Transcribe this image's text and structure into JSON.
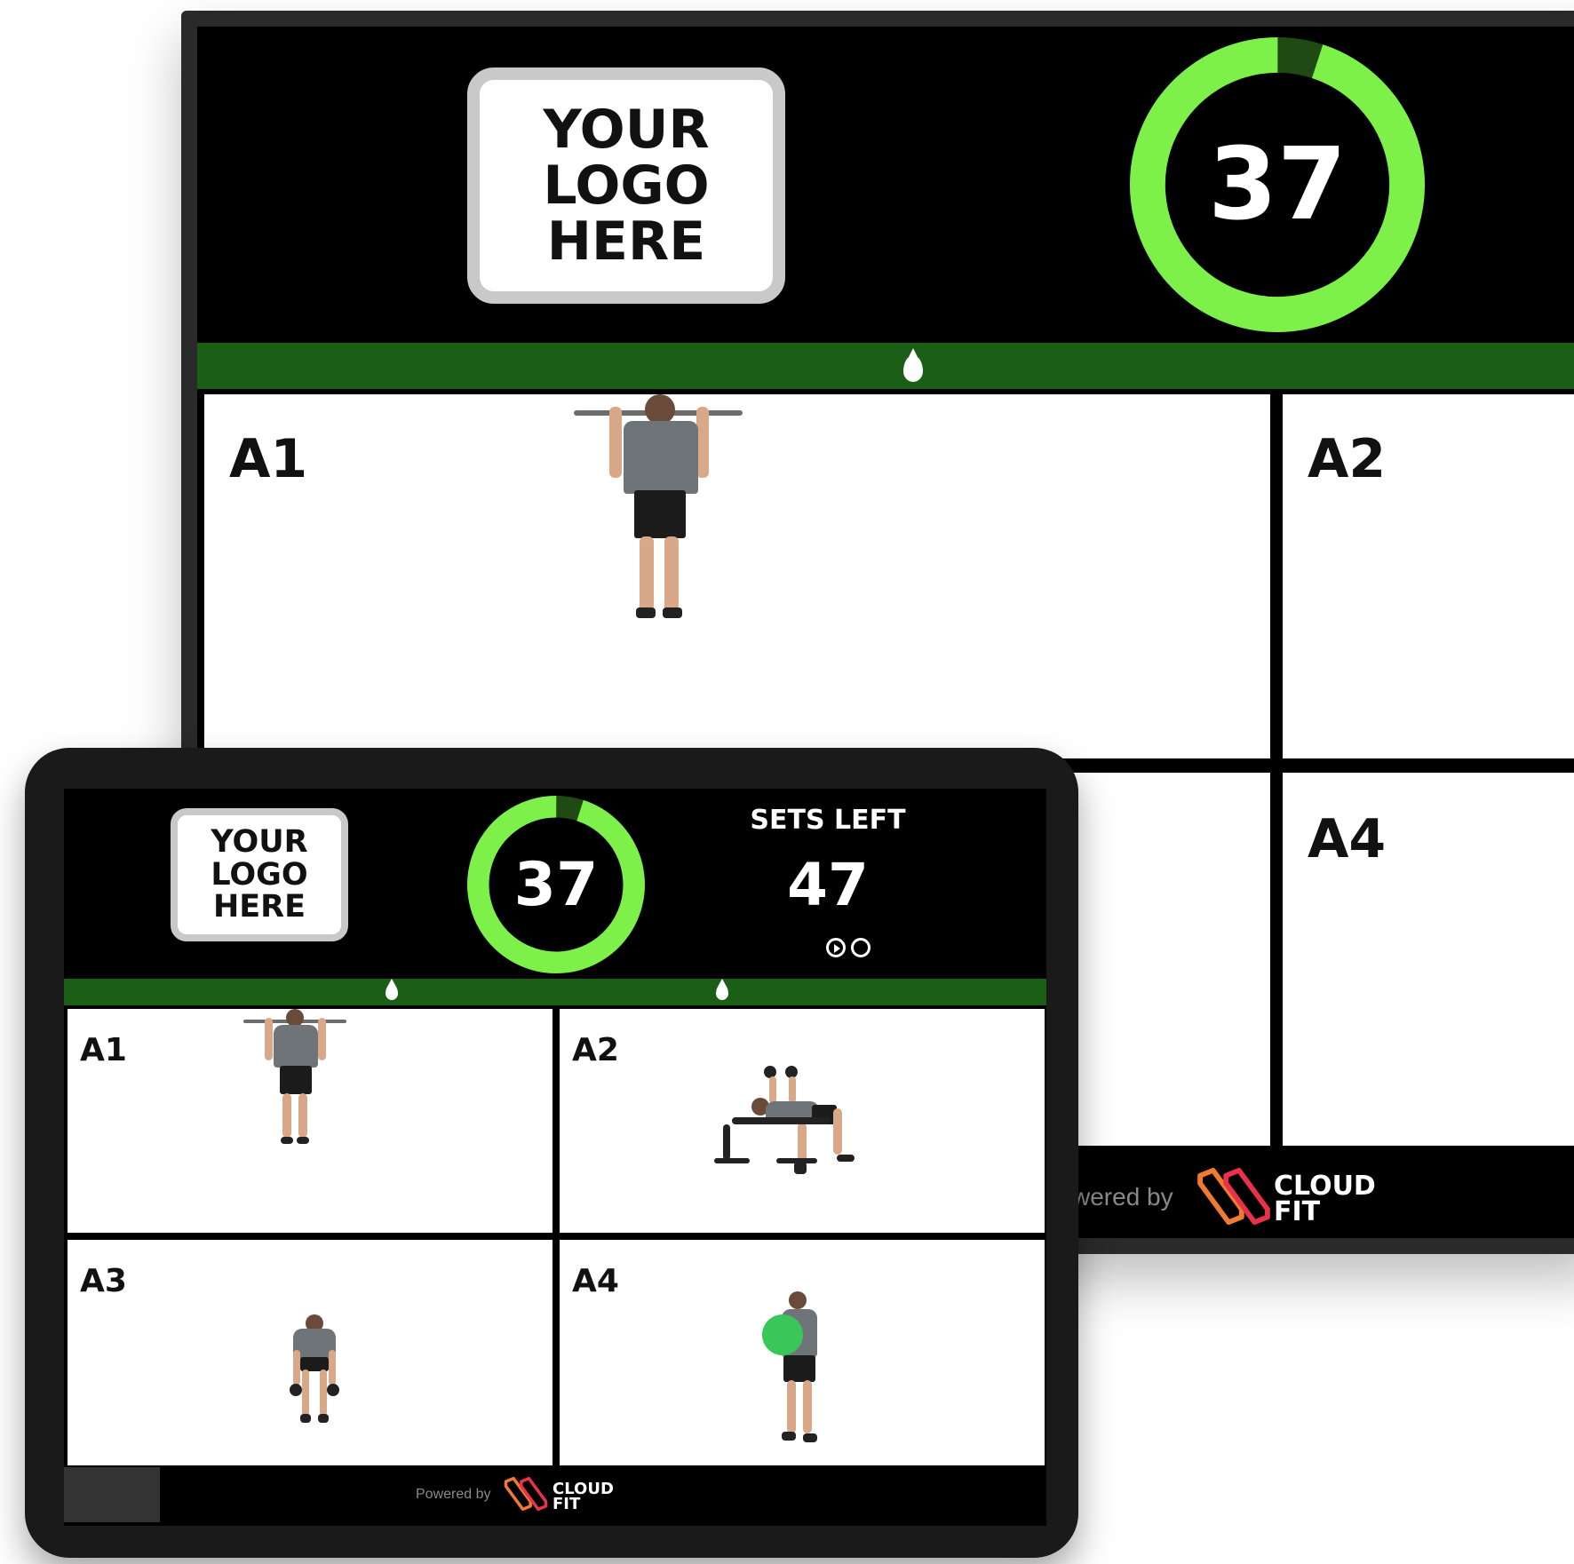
{
  "tv": {
    "logo": {
      "line1": "YOUR",
      "line2": "LOGO",
      "line3": "HERE"
    },
    "timer": {
      "value": "37",
      "progress": 0.95
    },
    "tiles": [
      {
        "label": "A1"
      },
      {
        "label": "A2"
      },
      {
        "label": "A4"
      }
    ],
    "footer": {
      "powered": "wered by",
      "brand_line1": "CLOUD",
      "brand_line2": "FIT"
    }
  },
  "tablet": {
    "logo": {
      "line1": "YOUR",
      "line2": "LOGO",
      "line3": "HERE"
    },
    "timer": {
      "value": "37",
      "progress": 0.95
    },
    "sets": {
      "title": "SETS LEFT",
      "value": "47"
    },
    "tiles": [
      {
        "label": "A1"
      },
      {
        "label": "A2"
      },
      {
        "label": "A3"
      },
      {
        "label": "A4"
      }
    ],
    "footer": {
      "powered": "Powered by",
      "brand_line1": "CLOUD",
      "brand_line2": "FIT"
    }
  },
  "colors": {
    "ring_active": "#7df04a",
    "ring_remaining": "#1f4a14",
    "header_bar": "#1b5e16",
    "brand_red": "#e8324a",
    "brand_orange": "#f07a30"
  },
  "icons": [
    "water-drop-icon",
    "play-circle-icon",
    "circle-icon",
    "cloudfit-logo-icon"
  ]
}
